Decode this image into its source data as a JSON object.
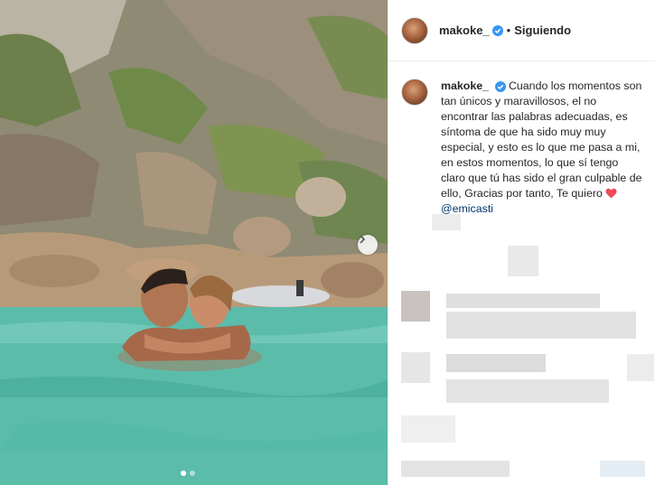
{
  "post": {
    "username": "makoke_",
    "separator": "•",
    "follow_status": "Siguiendo",
    "caption_text": "Cuando los momentos son tan únicos y maravillosos, el no encontrar las palabras adecuadas, es síntoma de que ha sido muy muy especial, y esto es lo que me pasa a mi, en estos momentos, lo que sí tengo claro que tú has sido el gran culpable de ello, Gracias por tanto, Te quiero",
    "mention": "@emicasti"
  },
  "carousel": {
    "slides": 2,
    "active": 1
  },
  "colors": {
    "verified": "#3897f0",
    "heart": "#ed4956",
    "mention": "#00376b"
  },
  "icons": [
    "verified-badge-icon",
    "chevron-right-icon",
    "heart-icon"
  ]
}
